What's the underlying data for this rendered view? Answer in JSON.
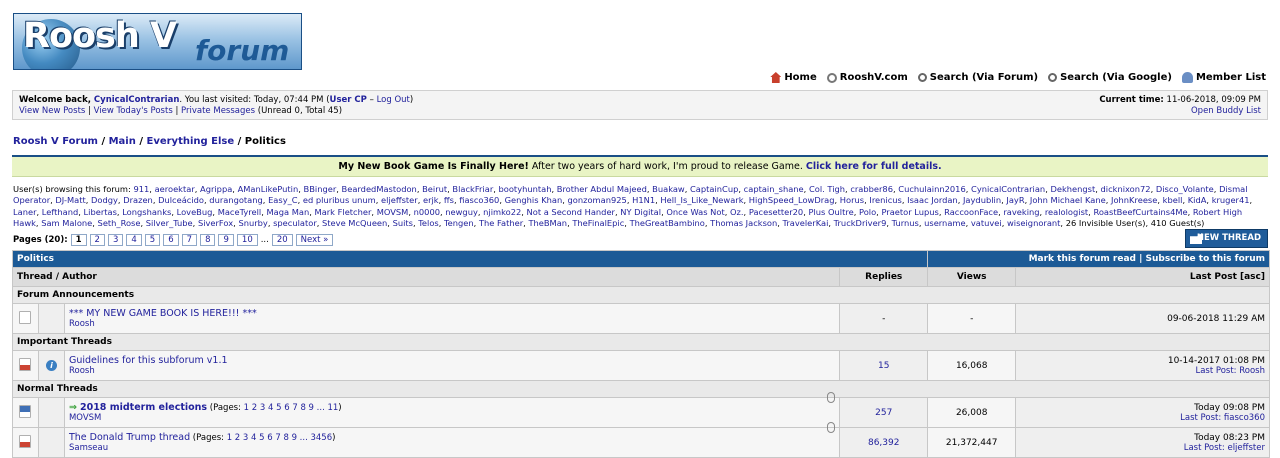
{
  "logo": {
    "text1": "Roosh V",
    "text2": "forum"
  },
  "topnav": [
    {
      "icon": "home-icon",
      "label": "Home"
    },
    {
      "icon": "link-icon",
      "label": "RooshV.com"
    },
    {
      "icon": "search-icon",
      "label": "Search (Via Forum)"
    },
    {
      "icon": "search-icon",
      "label": "Search (Via Google)"
    },
    {
      "icon": "members-icon",
      "label": "Member List"
    }
  ],
  "welcome": {
    "prefix": "Welcome back, ",
    "user": "CynicalContrarian",
    "visited": ". You last visited: Today, 07:44 PM (",
    "usercp": "User CP",
    "dash": " – ",
    "logout": "Log Out",
    "close": ")",
    "link_new": "View New Posts",
    "sep": " | ",
    "link_today": "View Today's Posts",
    "link_pm": "Private Messages",
    "pm_info": " (Unread 0, Total 45)",
    "time_label": "Current time:",
    "time_value": " 11-06-2018, 09:09 PM",
    "buddy": "Open Buddy List"
  },
  "breadcrumb": [
    {
      "label": "Roosh V Forum",
      "link": true
    },
    {
      "label": "Main",
      "link": true
    },
    {
      "label": "Everything Else",
      "link": true
    },
    {
      "label": "Politics",
      "link": false
    }
  ],
  "breadcrumb_sep": " / ",
  "notice": {
    "bold": "My New Book Game Is Finally Here!",
    "text": " After two years of hard work, I'm proud to release Game. ",
    "link": "Click here for full details."
  },
  "browsing": {
    "label": "User(s) browsing this forum: ",
    "users": [
      "911",
      "aeroektar",
      "Agrippa",
      "AManLikePutin",
      "BBinger",
      "BeardedMastodon",
      "Beirut",
      "BlackFriar",
      "bootyhuntah",
      "Brother Abdul Majeed",
      "Buakaw",
      "CaptainCup",
      "captain_shane",
      "Col. Tigh",
      "crabber86",
      "Cuchulainn2016",
      "CynicalContrarian",
      "Dekhengst",
      "dicknixon72",
      "Disco_Volante",
      "Dismal Operator",
      "DJ-Matt",
      "Dodgy",
      "Drazen",
      "Dulceácido",
      "durangotang",
      "Easy_C",
      "ed pluribus unum",
      "eljeffster",
      "erjk",
      "ffs",
      "fiasco360",
      "Genghis Khan",
      "gonzoman925",
      "H1N1",
      "Hell_Is_Like_Newark",
      "HighSpeed_LowDrag",
      "Horus",
      "Irenicus",
      "Isaac Jordan",
      "Jaydublin",
      "JayR",
      "John Michael Kane",
      "JohnKreese",
      "kbell",
      "KidA",
      "kruger41",
      "Laner",
      "Lefthand",
      "Libertas",
      "Longshanks",
      "LoveBug",
      "MaceTyrell",
      "Maga Man",
      "Mark Fletcher",
      "MOVSM",
      "n0000",
      "newguy",
      "njimko22",
      "Not a Second Hander",
      "NY Digital",
      "Once Was Not",
      "Oz.",
      "Pacesetter20",
      "Plus Oultre",
      "Polo",
      "Praetor Lupus",
      "RaccoonFace",
      "raveking",
      "realologist",
      "RoastBeefCurtains4Me",
      "Robert High Hawk",
      "Sam Malone",
      "Seth_Rose",
      "Silver_Tube",
      "SiverFox",
      "Snurby",
      "speculator",
      "Steve McQueen",
      "Suits",
      "Telos",
      "Tengen",
      "The Father",
      "TheBMan",
      "TheFinalEpic",
      "TheGreatBambino",
      "Thomas Jackson",
      "TravelerKai",
      "TruckDriver9",
      "Turnus",
      "username",
      "vatuvei",
      "wiseignorant"
    ],
    "tail": ", 26 Invisible User(s), 410 Guest(s)"
  },
  "pagination": {
    "label": "Pages (20):",
    "pages": [
      "1",
      "2",
      "3",
      "4",
      "5",
      "6",
      "7",
      "8",
      "9",
      "10"
    ],
    "ellipsis": "...",
    "last": "20",
    "next": "Next »"
  },
  "new_thread": "NEW THREAD",
  "table": {
    "title": "Politics",
    "mark_read": "Mark this forum read",
    "sep": " | ",
    "subscribe": "Subscribe to this forum",
    "col_thread": "Thread / Author",
    "col_replies": "Replies",
    "col_views": "Views",
    "col_lastpost": "Last Post [asc]",
    "sec_announcements": "Forum Announcements",
    "sec_important": "Important Threads",
    "sec_normal": "Normal Threads",
    "announcement": {
      "title": "*** MY NEW GAME BOOK IS HERE!!! ***",
      "author": "Roosh",
      "replies": "-",
      "views": "-",
      "last": "09-06-2018 11:29 AM"
    },
    "important": {
      "title": "Guidelines for this subforum v1.1",
      "author": "Roosh",
      "replies": "15",
      "views": "16,068",
      "date": "10-14-2017 01:08 PM",
      "lp_label": "Last Post: ",
      "lp_user": "Roosh"
    },
    "normal": [
      {
        "title": "2018 midterm elections",
        "pages_prefix": " (Pages: ",
        "pages": "1 2 3 4 5 6 7 8 9 ... 11",
        "pages_suffix": ")",
        "author": "MOVSM",
        "replies": "257",
        "views": "26,008",
        "date": "Today 09:08 PM",
        "lp_label": "Last Post: ",
        "lp_user": "fiasco360"
      },
      {
        "title": "The Donald Trump thread",
        "pages_prefix": " (Pages: ",
        "pages": "1 2 3 4 5 6 7 8 9 ... 3456",
        "pages_suffix": ")",
        "author": "Samseau",
        "replies": "86,392",
        "views": "21,372,447",
        "date": "Today 08:23 PM",
        "lp_label": "Last Post: ",
        "lp_user": "eljeffster"
      }
    ]
  }
}
